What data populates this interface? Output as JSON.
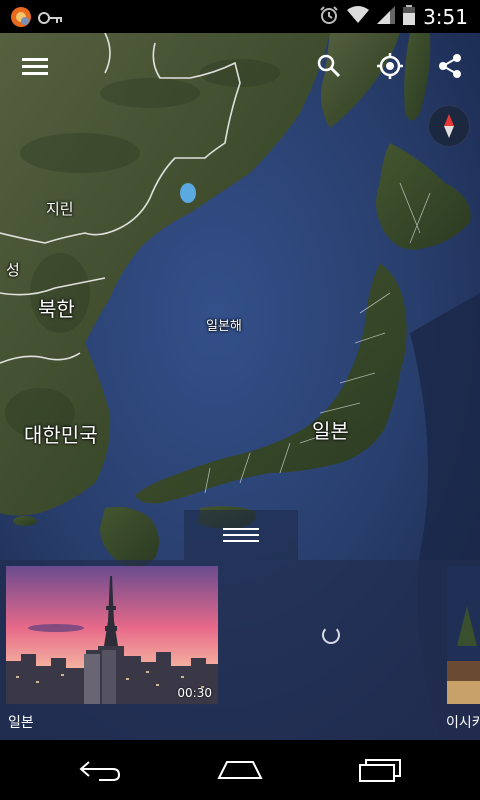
{
  "status_bar": {
    "time": "3:51",
    "notification_icons": [
      "app-notification-icon",
      "key-icon"
    ],
    "system_icons": [
      "alarm-icon",
      "wifi-icon",
      "signal-icon",
      "battery-icon"
    ]
  },
  "toolbar": {
    "menu_icon": "menu-icon",
    "search_icon": "search-icon",
    "location_icon": "my-location-icon",
    "share_icon": "share-icon",
    "compass_icon": "compass-icon"
  },
  "map_labels": {
    "jilin": "지린",
    "partial_left": "성",
    "north_korea": "북한",
    "sea_of_japan": "일본해",
    "south_korea": "대한민국",
    "japan": "일본"
  },
  "sheet": {
    "handle_icon": "drawer-handle-icon",
    "card_title": "일본",
    "card_duration": "00:30",
    "next_card_title": "이시카"
  },
  "nav_bar": {
    "back_icon": "back-icon",
    "home_icon": "home-icon",
    "recents_icon": "recents-icon"
  },
  "colors": {
    "ocean": "#2a3f6e",
    "land": "#3d4a2c",
    "sheet": "#222e50",
    "status_bar": "#000000"
  }
}
